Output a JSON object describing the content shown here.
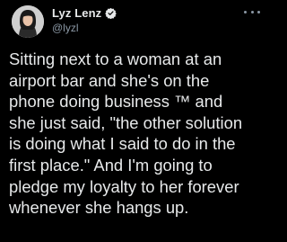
{
  "author": {
    "display_name": "Lyz Lenz",
    "handle": "@lyzl",
    "verified": true,
    "avatar_icon": "profile-photo"
  },
  "tweet": {
    "text_lines": [
      "Sitting next to a woman at an",
      "airport bar and she's on the",
      "phone doing business ™ and",
      "she just said, \"the other solution",
      "is doing what I said to do in the",
      "first place.\" And I'm going to",
      "pledge my loyalty to her forever",
      "whenever she hangs up."
    ]
  },
  "menu": {
    "icon": "more-options-icon"
  },
  "colors": {
    "background": "#000000",
    "text": "#e7e9ea",
    "secondary": "#8b98a5",
    "verified_badge": "#1d9bf0"
  }
}
